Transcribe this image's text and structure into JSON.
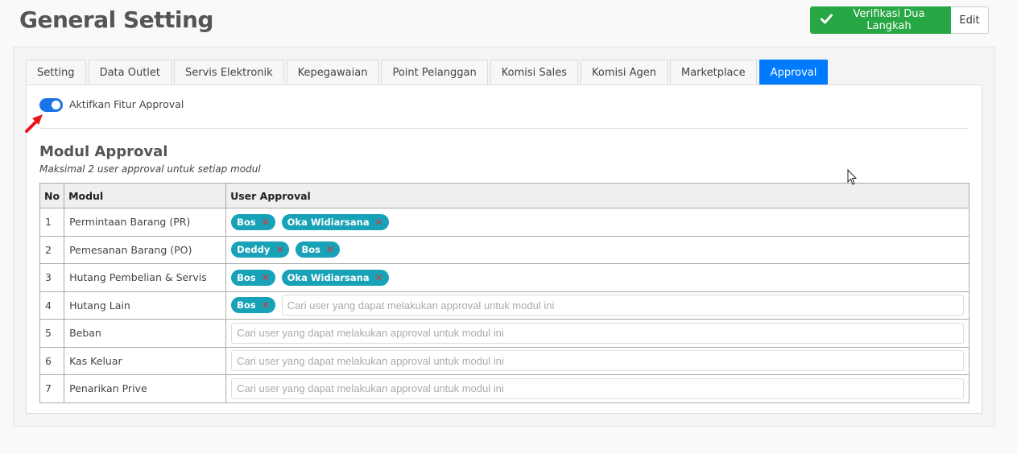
{
  "header": {
    "title": "General Setting",
    "verify_label": "Verifikasi Dua Langkah",
    "edit_label": "Edit"
  },
  "tabs": [
    {
      "label": "Setting",
      "active": false
    },
    {
      "label": "Data Outlet",
      "active": false
    },
    {
      "label": "Servis Elektronik",
      "active": false
    },
    {
      "label": "Kepegawaian",
      "active": false
    },
    {
      "label": "Point Pelanggan",
      "active": false
    },
    {
      "label": "Komisi Sales",
      "active": false
    },
    {
      "label": "Komisi Agen",
      "active": false
    },
    {
      "label": "Marketplace",
      "active": false
    },
    {
      "label": "Approval",
      "active": true
    }
  ],
  "toggle": {
    "label": "Aktifkan Fitur Approval",
    "enabled": true
  },
  "section": {
    "title": "Modul Approval",
    "subtitle": "Maksimal 2 user approval untuk setiap modul"
  },
  "table": {
    "headers": {
      "no": "No",
      "modul": "Modul",
      "users": "User Approval"
    },
    "placeholder": "Cari user yang dapat melakukan approval untuk modul ini",
    "rows": [
      {
        "no": "1",
        "modul": "Permintaan Barang (PR)",
        "users": [
          "Bos",
          "Oka Widiarsana"
        ]
      },
      {
        "no": "2",
        "modul": "Pemesanan Barang (PO)",
        "users": [
          "Deddy",
          "Bos"
        ]
      },
      {
        "no": "3",
        "modul": "Hutang Pembelian & Servis",
        "users": [
          "Bos",
          "Oka Widiarsana"
        ]
      },
      {
        "no": "4",
        "modul": "Hutang Lain",
        "users": [
          "Bos"
        ]
      },
      {
        "no": "5",
        "modul": "Beban",
        "users": []
      },
      {
        "no": "6",
        "modul": "Kas Keluar",
        "users": []
      },
      {
        "no": "7",
        "modul": "Penarikan Prive",
        "users": []
      }
    ]
  },
  "colors": {
    "accent": "#007bff",
    "success": "#28a745",
    "tag": "#17a2b8",
    "remove": "#e0323a",
    "arrow": "#e8141b"
  },
  "icons": {
    "verify": "check-icon",
    "remove": "close-icon",
    "pointer": "red-arrow-icon",
    "mouse": "mouse-cursor-icon"
  }
}
